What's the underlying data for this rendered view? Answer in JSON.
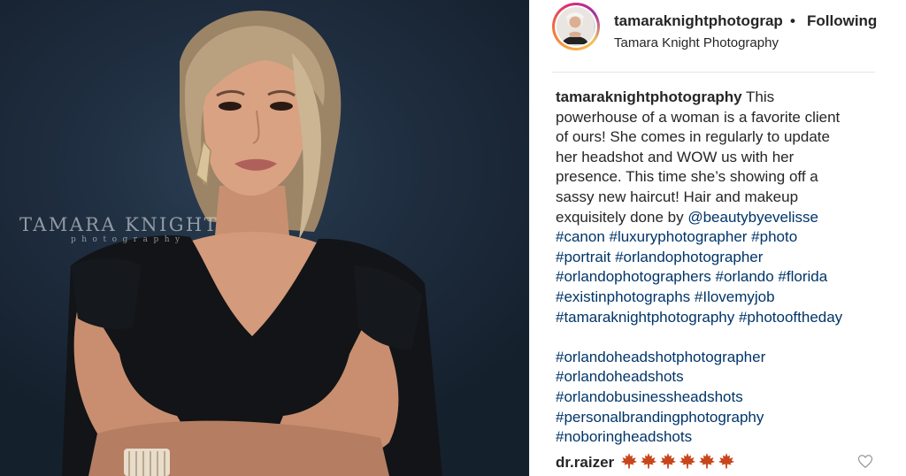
{
  "photo": {
    "watermark_main": "TAMARA KNIGHT",
    "watermark_sub": "photography"
  },
  "header": {
    "username": "tamaraknightphotograp",
    "separator": "•",
    "follow_status": "Following",
    "display_name": "Tamara Knight Photography"
  },
  "caption": {
    "username": "tamaraknightphotography",
    "lines": [
      " This",
      "powerhouse of a woman is a favorite client",
      "of ours! She comes in regularly to update",
      "her headshot and WOW us with her",
      "presence. This time she’s showing off a",
      "sassy new haircut! Hair and makeup",
      "exquisitely done by "
    ],
    "mention": "@beautybyevelisse",
    "hashtag_lines": [
      "#canon #luxuryphotographer #photo",
      "#portrait #orlandophotographer",
      "#orlandophotographers #orlando #florida",
      "#existinphotographs #Ilovemyjob",
      "#tamaraknightphotography #photooftheday"
    ],
    "hashtag_lines_2": [
      "#orlandoheadshotphotographer",
      "#orlandoheadshots",
      "#orlandobusinessheadshots",
      "#personalbrandingphotography",
      "#noboringheadshots"
    ]
  },
  "comment": {
    "username": "dr.raizer",
    "emoji": "maple-leaf-icon",
    "emoji_count": 6
  },
  "colors": {
    "link": "#003569",
    "text": "#262626",
    "leaf": "#c8461b"
  }
}
